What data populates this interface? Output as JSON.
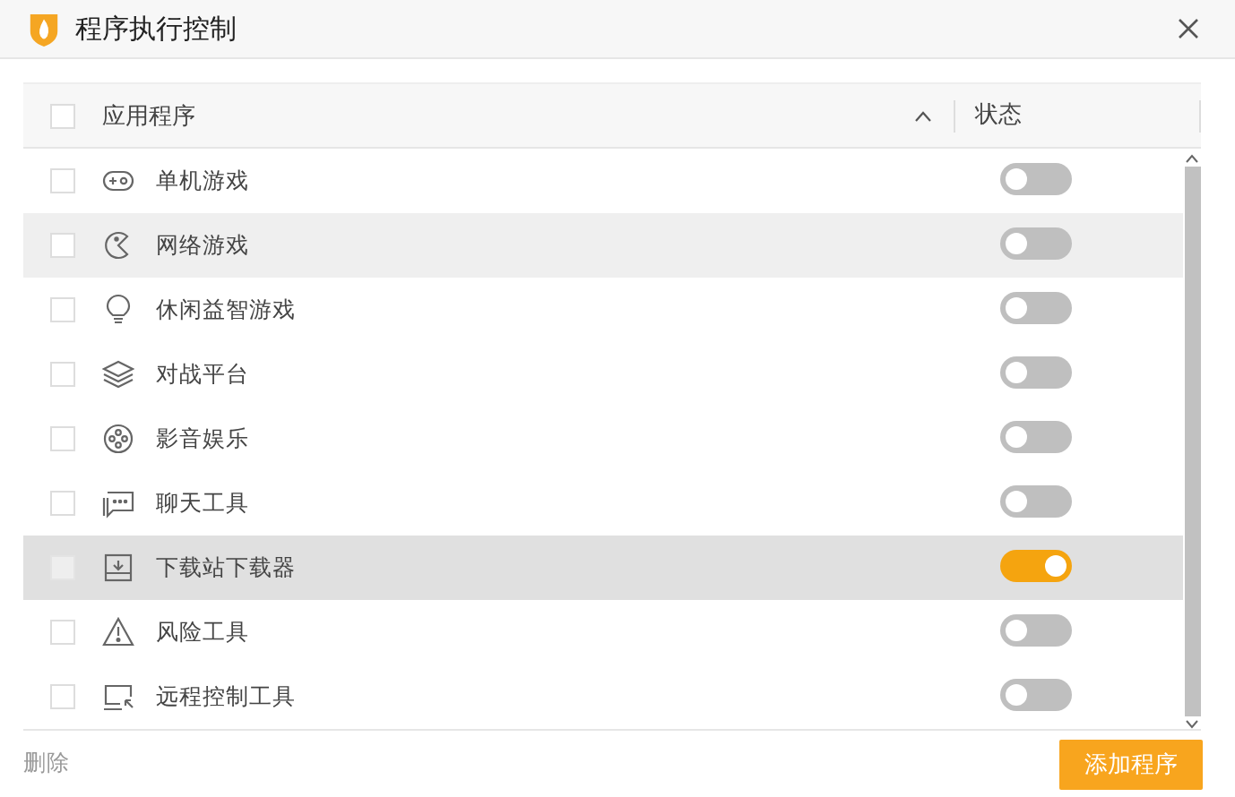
{
  "window": {
    "title": "程序执行控制"
  },
  "table": {
    "select_all_checked": false,
    "columns": [
      {
        "label": "应用程序"
      },
      {
        "label": "状态"
      }
    ],
    "rows": [
      {
        "name": "单机游戏",
        "checked": false,
        "on": false,
        "selected": false,
        "hovered": false
      },
      {
        "name": "网络游戏",
        "checked": false,
        "on": false,
        "selected": false,
        "hovered": true
      },
      {
        "name": "休闲益智游戏",
        "checked": false,
        "on": false,
        "selected": false,
        "hovered": false
      },
      {
        "name": "对战平台",
        "checked": false,
        "on": false,
        "selected": false,
        "hovered": false
      },
      {
        "name": "影音娱乐",
        "checked": false,
        "on": false,
        "selected": false,
        "hovered": false
      },
      {
        "name": "聊天工具",
        "checked": false,
        "on": false,
        "selected": false,
        "hovered": false
      },
      {
        "name": "下载站下载器",
        "checked": false,
        "on": true,
        "selected": true,
        "hovered": false
      },
      {
        "name": "风险工具",
        "checked": false,
        "on": false,
        "selected": false,
        "hovered": false
      },
      {
        "name": "远程控制工具",
        "checked": false,
        "on": false,
        "selected": false,
        "hovered": false
      }
    ]
  },
  "footer": {
    "delete": "删除",
    "add": "添加程序"
  }
}
